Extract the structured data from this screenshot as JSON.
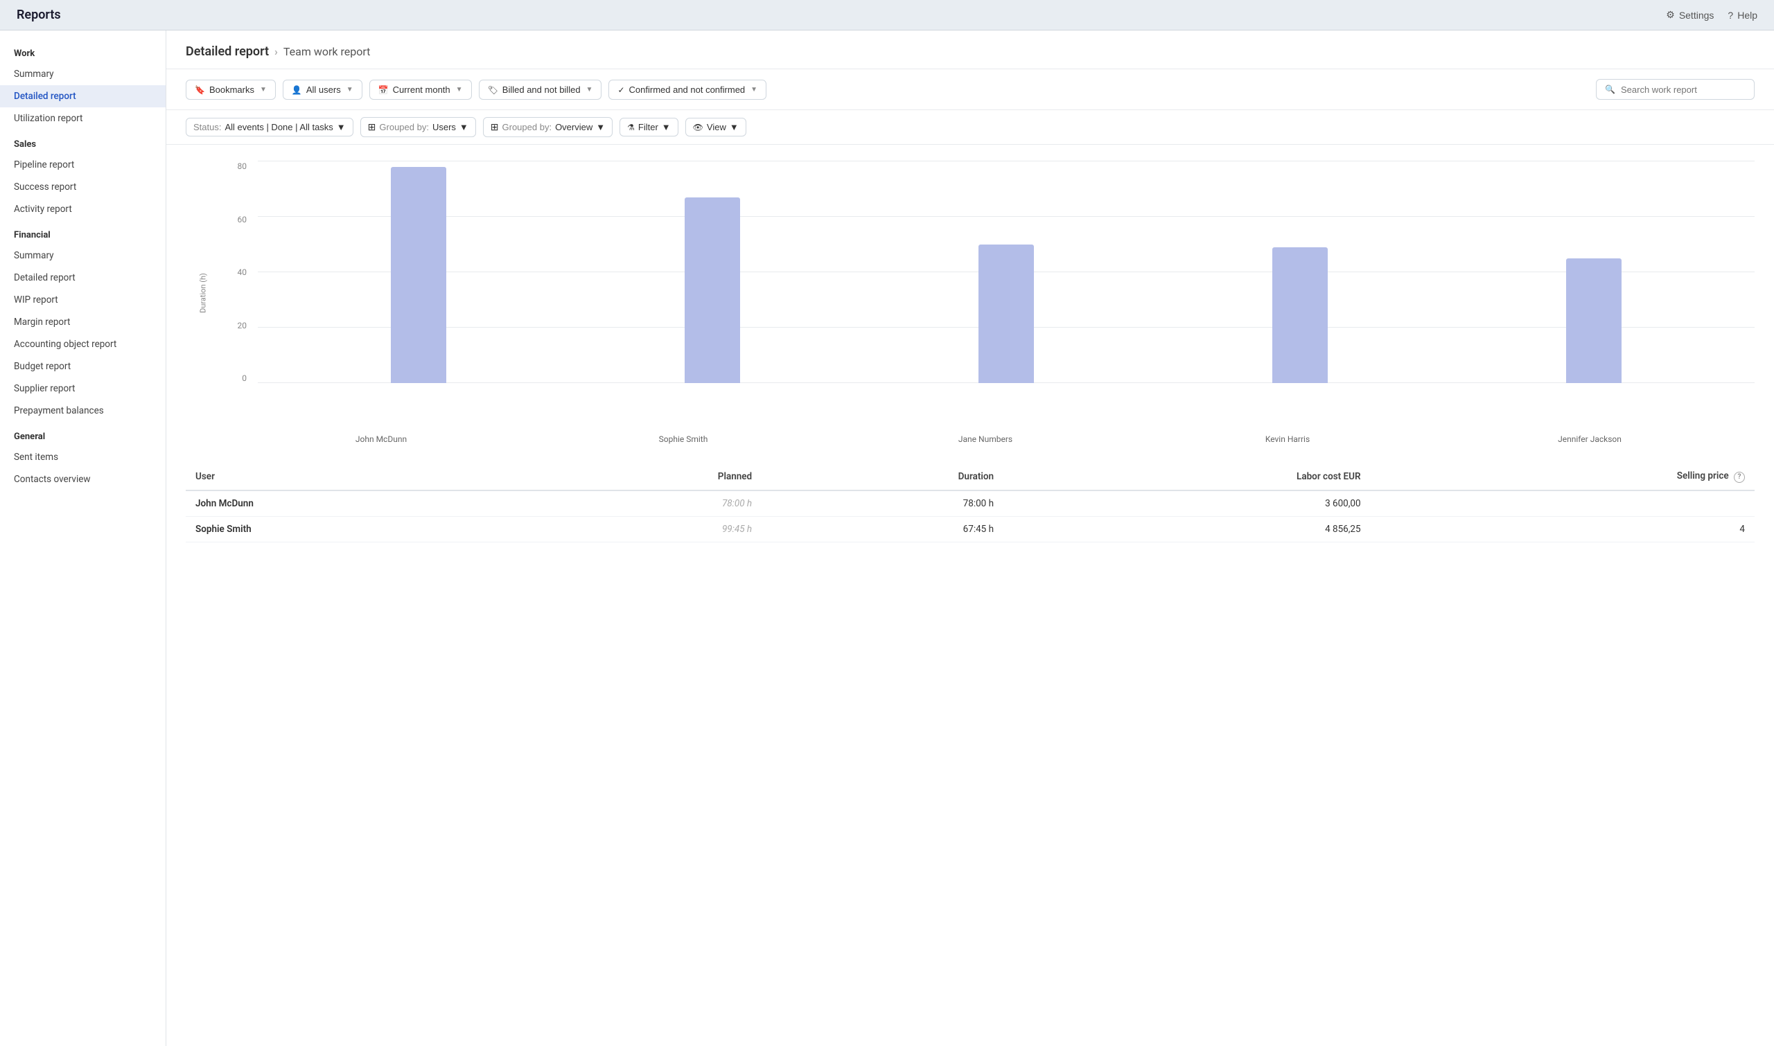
{
  "appHeader": {
    "title": "Reports",
    "settings_label": "Settings",
    "help_label": "Help"
  },
  "sidebar": {
    "sections": [
      {
        "label": "Work",
        "items": [
          {
            "id": "summary-work",
            "label": "Summary",
            "active": false
          },
          {
            "id": "detailed-report",
            "label": "Detailed report",
            "active": true
          },
          {
            "id": "utilization-report",
            "label": "Utilization report",
            "active": false
          }
        ]
      },
      {
        "label": "Sales",
        "items": [
          {
            "id": "pipeline-report",
            "label": "Pipeline report",
            "active": false
          },
          {
            "id": "success-report",
            "label": "Success report",
            "active": false
          },
          {
            "id": "activity-report",
            "label": "Activity report",
            "active": false
          }
        ]
      },
      {
        "label": "Financial",
        "items": [
          {
            "id": "financial-summary",
            "label": "Summary",
            "active": false
          },
          {
            "id": "financial-detailed",
            "label": "Detailed report",
            "active": false
          },
          {
            "id": "wip-report",
            "label": "WIP report",
            "active": false
          },
          {
            "id": "margin-report",
            "label": "Margin report",
            "active": false
          },
          {
            "id": "accounting-report",
            "label": "Accounting object report",
            "active": false
          },
          {
            "id": "budget-report",
            "label": "Budget report",
            "active": false
          },
          {
            "id": "supplier-report",
            "label": "Supplier report",
            "active": false
          },
          {
            "id": "prepayment-balances",
            "label": "Prepayment balances",
            "active": false
          }
        ]
      },
      {
        "label": "General",
        "items": [
          {
            "id": "sent-items",
            "label": "Sent items",
            "active": false
          },
          {
            "id": "contacts-overview",
            "label": "Contacts overview",
            "active": false
          }
        ]
      }
    ]
  },
  "page": {
    "breadcrumb_root": "Detailed report",
    "breadcrumb_child": "Team work report"
  },
  "toolbar": {
    "bookmarks_label": "Bookmarks",
    "all_users_label": "All users",
    "current_month_label": "Current month",
    "billed_label": "Billed and not billed",
    "confirmed_label": "Confirmed and not confirmed",
    "search_placeholder": "Search work report"
  },
  "subToolbar": {
    "status_prefix": "Status:",
    "status_value": "All events | Done | All tasks",
    "grouped_by_1_prefix": "Grouped by:",
    "grouped_by_1_value": "Users",
    "grouped_by_2_prefix": "Grouped by:",
    "grouped_by_2_value": "Overview",
    "filter_label": "Filter",
    "view_label": "View"
  },
  "chart": {
    "y_axis_title": "Duration (h)",
    "y_labels": [
      "0",
      "20",
      "40",
      "60",
      "80"
    ],
    "bars": [
      {
        "name": "John McDunn",
        "value": 78,
        "height_pct": 97
      },
      {
        "name": "Sophie Smith",
        "value": 67,
        "height_pct": 83
      },
      {
        "name": "Jane Numbers",
        "value": 50,
        "height_pct": 62
      },
      {
        "name": "Kevin Harris",
        "value": 49,
        "height_pct": 61
      },
      {
        "name": "Jennifer Jackson",
        "value": 45,
        "height_pct": 56
      }
    ]
  },
  "table": {
    "columns": [
      {
        "id": "user",
        "label": "User"
      },
      {
        "id": "planned",
        "label": "Planned"
      },
      {
        "id": "duration",
        "label": "Duration"
      },
      {
        "id": "labor_cost",
        "label": "Labor cost EUR"
      },
      {
        "id": "selling_price",
        "label": "Selling price"
      }
    ],
    "rows": [
      {
        "user": "John McDunn",
        "planned": "78:00 h",
        "duration": "78:00 h",
        "labor_cost": "3 600,00",
        "selling_price": ""
      },
      {
        "user": "Sophie Smith",
        "planned": "99:45 h",
        "duration": "67:45 h",
        "labor_cost": "4 856,25",
        "selling_price": "4"
      }
    ]
  }
}
